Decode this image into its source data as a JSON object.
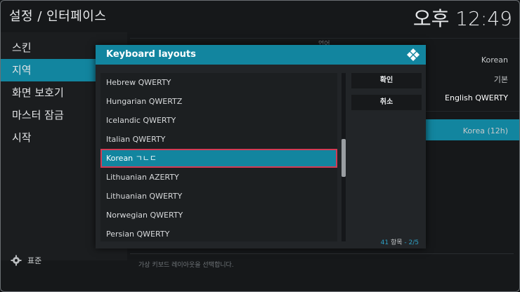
{
  "header": {
    "title": "설정 / 인터페이스",
    "clock": "오후 12:49"
  },
  "sidebar": {
    "items": [
      {
        "label": "스킨"
      },
      {
        "label": "지역"
      },
      {
        "label": "화면 보호기"
      },
      {
        "label": "마스터 잠금"
      },
      {
        "label": "시작"
      }
    ],
    "active_index": 1
  },
  "right_pane": {
    "section_label": "언어",
    "values": [
      "Korean",
      "기본",
      "English QWERTY",
      "Korea (12h)"
    ]
  },
  "dialog": {
    "title": "Keyboard layouts",
    "items": [
      "Hebrew QWERTY",
      "Hungarian QWERTZ",
      "Icelandic QWERTY",
      "Italian QWERTY",
      "Korean ㄱㄴㄷ",
      "Lithuanian AZERTY",
      "Lithuanian QWERTY",
      "Norwegian QWERTY",
      "Persian QWERTY"
    ],
    "selected_index": 4,
    "ok_label": "확인",
    "cancel_label": "취소",
    "count_items": "41",
    "count_items_label": "항목",
    "count_page": "2/5"
  },
  "footer": {
    "left_label": "표준",
    "hint": "가상 키보드 레이아웃을 선택합니다."
  },
  "colors": {
    "accent": "#12859f",
    "focus_border": "#d23b54",
    "background": "#16181a"
  },
  "icons": {
    "settings": "gear-icon",
    "dialog": "kodi-logo-icon"
  }
}
